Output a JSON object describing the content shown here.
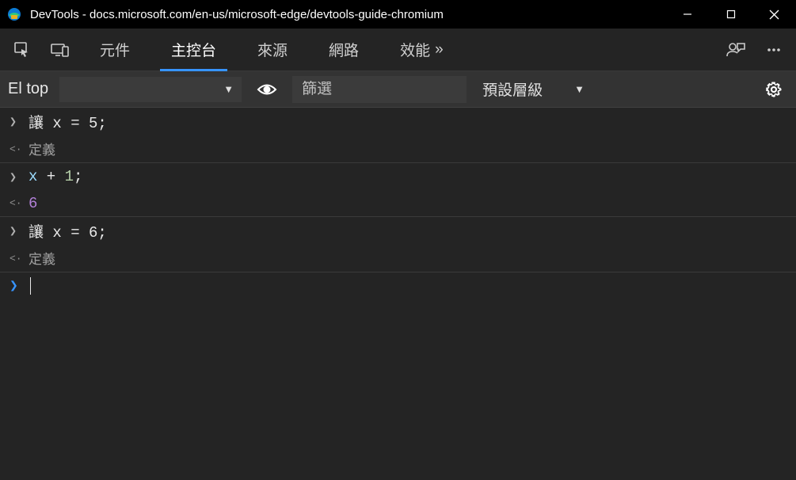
{
  "window": {
    "title": "DevTools - docs.microsoft.com/en-us/microsoft-edge/devtools-guide-chromium"
  },
  "tabs": {
    "items": [
      "元件",
      "主控台",
      "來源",
      "網路",
      "效能"
    ],
    "active_index": 1,
    "more_indicator": "»"
  },
  "filterbar": {
    "context_label": "El top",
    "filter_placeholder": "篩選",
    "level_label": "預設層級"
  },
  "console": {
    "entries": [
      {
        "type": "input",
        "text": "讓 x = 5;"
      },
      {
        "type": "output",
        "text": "定義"
      },
      {
        "type": "input_expr",
        "var": "x",
        "op": " + ",
        "num": "1",
        "semi": ";"
      },
      {
        "type": "result",
        "text": "6"
      },
      {
        "type": "input",
        "text": "讓 x = 6;"
      },
      {
        "type": "output",
        "text": "定義"
      }
    ]
  }
}
